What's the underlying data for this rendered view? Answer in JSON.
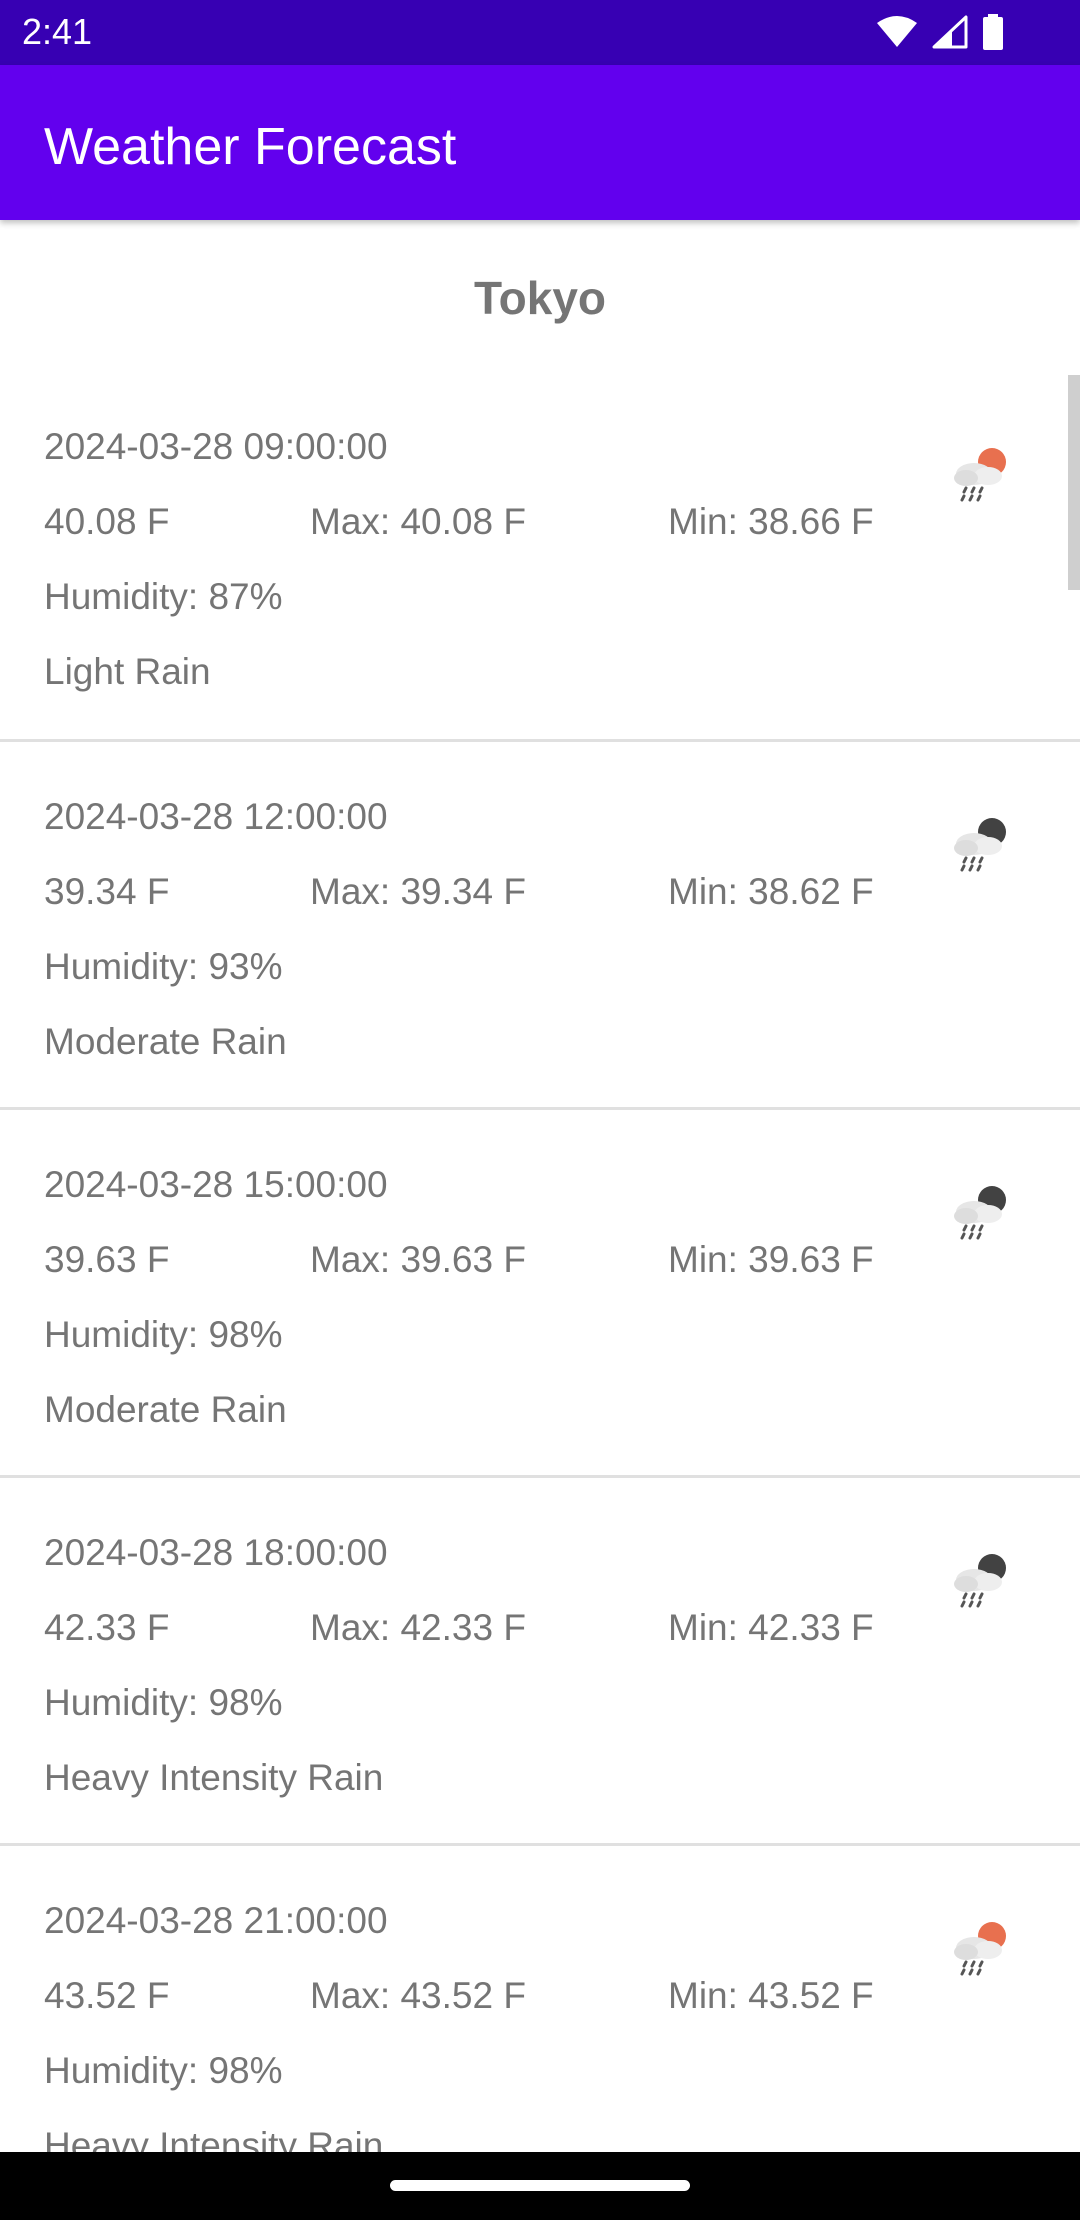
{
  "status_bar": {
    "time": "2:41",
    "icons": [
      "wifi-icon",
      "signal-icon",
      "battery-icon"
    ]
  },
  "app_bar": {
    "title": "Weather Forecast"
  },
  "city": "Tokyo",
  "forecasts": [
    {
      "datetime": "2024-03-28 09:00:00",
      "temp": "40.08 F",
      "max": "Max: 40.08 F",
      "min": "Min: 38.66 F",
      "humidity": "Humidity: 87%",
      "description": "Light Rain",
      "icon": "rain-day-icon"
    },
    {
      "datetime": "2024-03-28 12:00:00",
      "temp": "39.34 F",
      "max": "Max: 39.34 F",
      "min": "Min: 38.62 F",
      "humidity": "Humidity: 93%",
      "description": "Moderate Rain",
      "icon": "rain-night-icon"
    },
    {
      "datetime": "2024-03-28 15:00:00",
      "temp": "39.63 F",
      "max": "Max: 39.63 F",
      "min": "Min: 39.63 F",
      "humidity": "Humidity: 98%",
      "description": "Moderate Rain",
      "icon": "rain-night-icon"
    },
    {
      "datetime": "2024-03-28 18:00:00",
      "temp": "42.33 F",
      "max": "Max: 42.33 F",
      "min": "Min: 42.33 F",
      "humidity": "Humidity: 98%",
      "description": "Heavy Intensity Rain",
      "icon": "rain-night-icon"
    },
    {
      "datetime": "2024-03-28 21:00:00",
      "temp": "43.52 F",
      "max": "Max: 43.52 F",
      "min": "Min: 43.52 F",
      "humidity": "Humidity: 98%",
      "description": "Heavy Intensity Rain",
      "icon": "rain-day-icon"
    }
  ],
  "colors": {
    "status_bar": "#3700b3",
    "app_bar": "#6200ee",
    "text_secondary": "#757575",
    "divider": "#e0e0e0",
    "sun_accent": "#e8704f",
    "moon_accent": "#424242"
  }
}
